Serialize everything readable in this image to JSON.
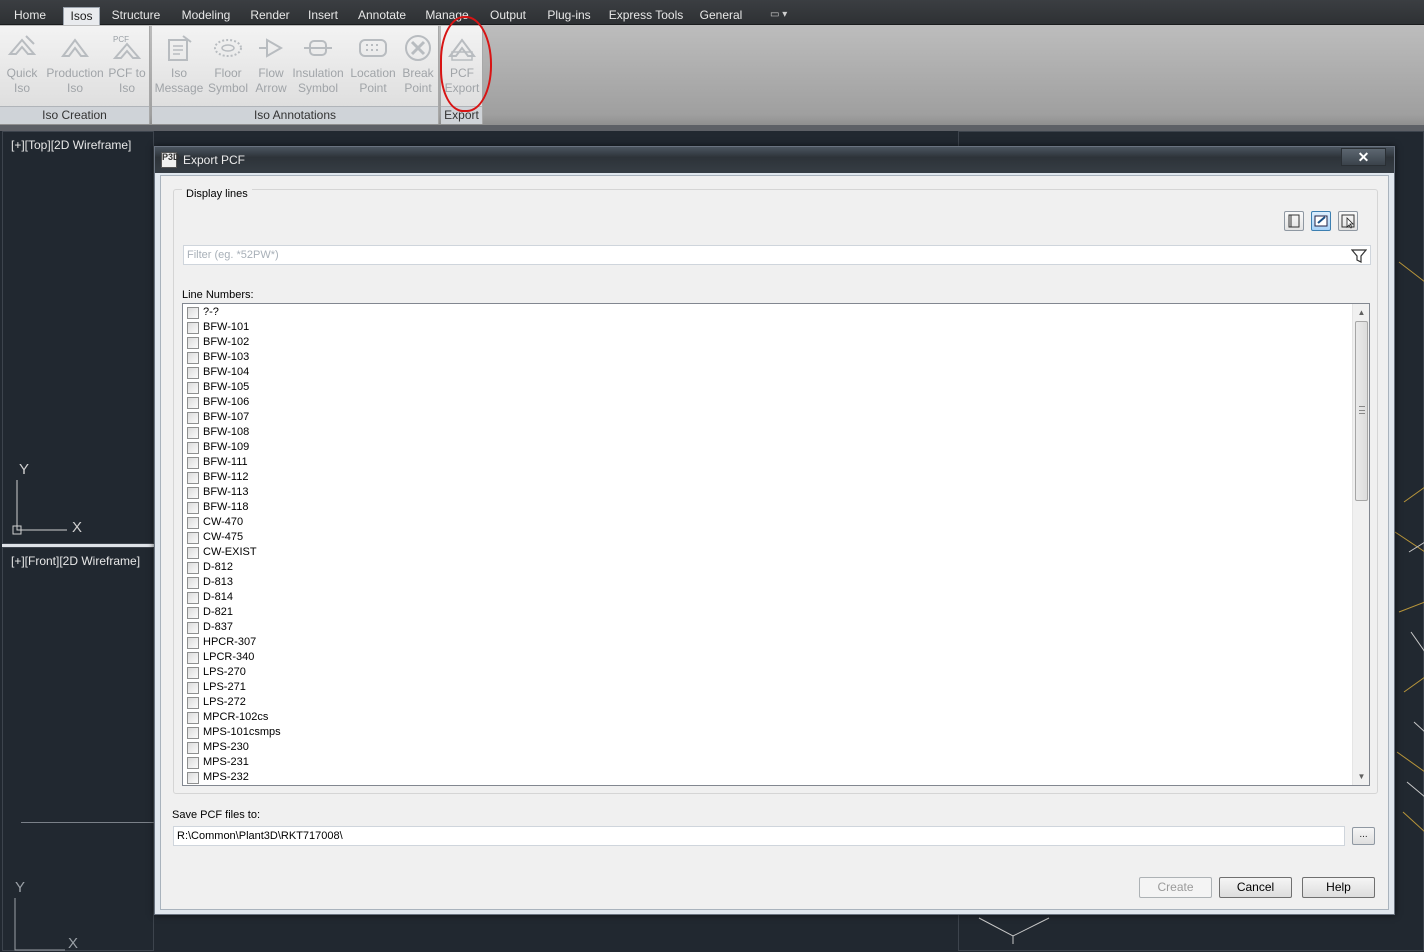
{
  "ribbon_tabs": [
    {
      "label": "Home"
    },
    {
      "label": "Isos",
      "active": true
    },
    {
      "label": "Structure"
    },
    {
      "label": "Modeling"
    },
    {
      "label": "Render"
    },
    {
      "label": "Insert"
    },
    {
      "label": "Annotate"
    },
    {
      "label": "Manage"
    },
    {
      "label": "Output"
    },
    {
      "label": "Plug-ins"
    },
    {
      "label": "Express Tools"
    },
    {
      "label": "General"
    }
  ],
  "ribbon_extra": "▭ ▾",
  "panels": {
    "iso_creation": {
      "title": "Iso Creation",
      "buttons": [
        {
          "line1": "Quick",
          "line2": "Iso",
          "icon": "quick-iso-icon"
        },
        {
          "line1": "Production",
          "line2": "Iso",
          "icon": "production-iso-icon"
        },
        {
          "line1": "PCF to",
          "line2": "Iso",
          "icon": "pcf-to-iso-icon"
        }
      ]
    },
    "iso_annotations": {
      "title": "Iso Annotations",
      "buttons": [
        {
          "line1": "Iso",
          "line2": "Message",
          "icon": "iso-message-icon"
        },
        {
          "line1": "Floor",
          "line2": "Symbol",
          "icon": "floor-symbol-icon"
        },
        {
          "line1": "Flow",
          "line2": "Arrow",
          "icon": "flow-arrow-icon"
        },
        {
          "line1": "Insulation",
          "line2": "Symbol",
          "icon": "insulation-symbol-icon"
        },
        {
          "line1": "Location",
          "line2": "Point",
          "icon": "location-point-icon"
        },
        {
          "line1": "Break",
          "line2": "Point",
          "icon": "break-point-icon"
        }
      ]
    },
    "export": {
      "title": "Export",
      "buttons": [
        {
          "line1": "PCF",
          "line2": "Export",
          "icon": "pcf-export-icon"
        }
      ]
    }
  },
  "viewports": {
    "top": {
      "label": "[+][Top][2D Wireframe]"
    },
    "front": {
      "label": "[+][Front][2D Wireframe]"
    }
  },
  "ucs": {
    "y": "Y",
    "x": "X"
  },
  "dialog": {
    "title": "Export PCF",
    "app_icon_text": "P3D",
    "close": "✕",
    "group_label": "Display lines",
    "filter_placeholder": "Filter (eg. *52PW*)",
    "line_numbers_label": "Line Numbers:",
    "line_numbers": [
      "?-?",
      "BFW-101",
      "BFW-102",
      "BFW-103",
      "BFW-104",
      "BFW-105",
      "BFW-106",
      "BFW-107",
      "BFW-108",
      "BFW-109",
      "BFW-111",
      "BFW-112",
      "BFW-113",
      "BFW-118",
      "CW-470",
      "CW-475",
      "CW-EXIST",
      "D-812",
      "D-813",
      "D-814",
      "D-821",
      "D-837",
      "HPCR-307",
      "LPCR-340",
      "LPS-270",
      "LPS-271",
      "LPS-272",
      "MPCR-102cs",
      "MPS-101csmps",
      "MPS-230",
      "MPS-231",
      "MPS-232"
    ],
    "save_label": "Save PCF files to:",
    "save_path": "R:\\Common\\Plant3D\\RKT717008\\",
    "browse": "...",
    "create": "Create",
    "cancel": "Cancel",
    "help": "Help"
  },
  "colors": {
    "highlight_ring": "#d81414",
    "viewport_bg": "#212830"
  }
}
